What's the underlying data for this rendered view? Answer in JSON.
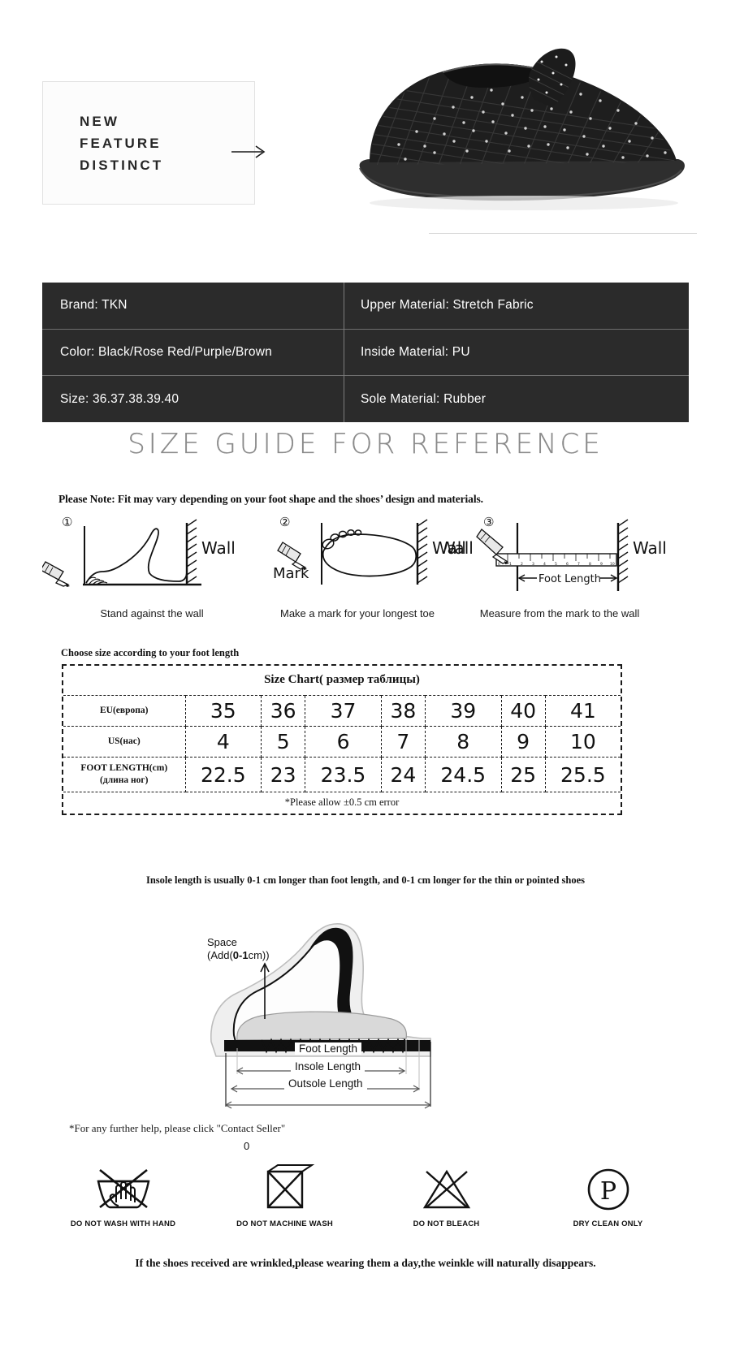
{
  "hero": {
    "line1": "NEW",
    "line2": "FEATURE",
    "line3": "DISTINCT",
    "arrow_icon": "arrow-right-icon",
    "product_image_alt": "black-woven-slip-on-shoe"
  },
  "spec": {
    "left": [
      "Brand: TKN",
      "Color: Black/Rose  Red/Purple/Brown",
      "Size:  36.37.38.39.40"
    ],
    "right": [
      "Upper  Material:  Stretch  Fabric",
      "Inside  Material:  PU",
      "Sole  Material:  Rubber"
    ],
    "bg_color": "#2b2b2b",
    "text_color": "#ffffff"
  },
  "guide": {
    "title": "SIZE GUIDE FOR REFERENCE",
    "note": "Please Note:  Fit may vary depending on your foot shape and the shoes’ design and materials.",
    "choose_line": "Choose size according to your foot length",
    "insole_note": "Insole length is usually 0-1 cm longer than foot length, and 0-1 cm longer for the thin or pointed shoes"
  },
  "steps": [
    {
      "number": "①",
      "caption": "Stand against the wall",
      "wall_label": "Wall",
      "mark_label": ""
    },
    {
      "number": "②",
      "caption": "Make a mark for your longest toe",
      "wall_label": "Wall",
      "mark_label": "Mark"
    },
    {
      "number": "③",
      "caption": "Measure from the mark to the wall",
      "wall_label": "Wall",
      "wall_label_left": "Wall",
      "foot_length_label": "Foot Length"
    }
  ],
  "chart_data": {
    "type": "table",
    "title": "Size Chart( размер таблицы)",
    "row_labels": [
      "EU(европа)",
      "US(нас)",
      "FOOT LENGTH(cm)\n(длина ног)"
    ],
    "rows": [
      {
        "label_main": "EU(европа)",
        "label_sub": "",
        "values": [
          "35",
          "36",
          "37",
          "38",
          "39",
          "40",
          "41"
        ]
      },
      {
        "label_main": "US(нас)",
        "label_sub": "",
        "values": [
          "4",
          "5",
          "6",
          "7",
          "8",
          "9",
          "10"
        ]
      },
      {
        "label_main": "FOOT LENGTH(cm)",
        "label_sub": "(длина ног)",
        "values": [
          "22.5",
          "23",
          "23.5",
          "24",
          "24.5",
          "25",
          "25.5"
        ]
      }
    ],
    "footnote": "*Please allow ±0.5 cm error"
  },
  "cross_section": {
    "space_label_line1": "Space",
    "space_label_prefix": "(Add(",
    "space_label_value": "0-1",
    "space_label_suffix": "cm))",
    "dims": [
      "Foot Length",
      "Insole Length",
      "Outsole Length"
    ]
  },
  "footer": {
    "contact_note": "*For any further help, please click \"Contact Seller\"",
    "zero_mark": "0",
    "care": [
      {
        "icon": "no-hand-wash-icon",
        "label": "DO NOT WASH WITH HAND"
      },
      {
        "icon": "no-machine-wash-icon",
        "label": "DO NOT MACHINE WASH"
      },
      {
        "icon": "no-bleach-icon",
        "label": "DO NOT BLEACH"
      },
      {
        "icon": "dry-clean-only-icon",
        "label": "DRY CLEAN ONLY"
      }
    ],
    "final_note": "If the shoes received are wrinkled,please wearing them a day,the weinkle will naturally disappears."
  }
}
